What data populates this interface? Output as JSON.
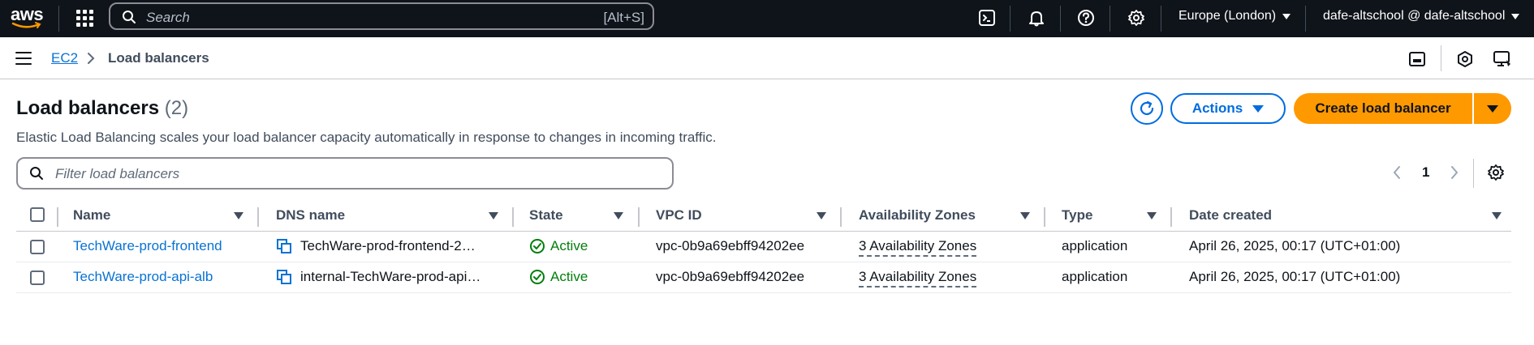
{
  "topnav": {
    "logo_text": "aws",
    "search_placeholder": "Search",
    "search_shortcut": "[Alt+S]",
    "region": "Europe (London)",
    "account": "dafe-altschool @ dafe-altschool",
    "icons": [
      "services-grid-icon",
      "cloudshell-icon",
      "bell-icon",
      "help-icon",
      "gear-icon"
    ]
  },
  "breadcrumb": {
    "parent": "EC2",
    "current": "Load balancers"
  },
  "header": {
    "title": "Load balancers",
    "count": "(2)",
    "description": "Elastic Load Balancing scales your load balancer capacity automatically in response to changes in incoming traffic.",
    "actions_label": "Actions",
    "create_label": "Create load balancer"
  },
  "filter": {
    "placeholder": "Filter load balancers"
  },
  "pagination": {
    "current_page": "1"
  },
  "table": {
    "columns": [
      "Name",
      "DNS name",
      "State",
      "VPC ID",
      "Availability Zones",
      "Type",
      "Date created"
    ],
    "rows": [
      {
        "name": "TechWare-prod-frontend",
        "dns": "TechWare-prod-frontend-2…",
        "state": "Active",
        "vpc": "vpc-0b9a69ebff94202ee",
        "az": "3 Availability Zones",
        "type": "application",
        "created": "April 26, 2025, 00:17 (UTC+01:00)"
      },
      {
        "name": "TechWare-prod-api-alb",
        "dns": "internal-TechWare-prod-api…",
        "state": "Active",
        "vpc": "vpc-0b9a69ebff94202ee",
        "az": "3 Availability Zones",
        "type": "application",
        "created": "April 26, 2025, 00:17 (UTC+01:00)"
      }
    ]
  },
  "colors": {
    "nav_bg": "#0f141a",
    "link": "#0972d3",
    "primary_button": "#ff9900",
    "status_active": "#037f0c"
  }
}
